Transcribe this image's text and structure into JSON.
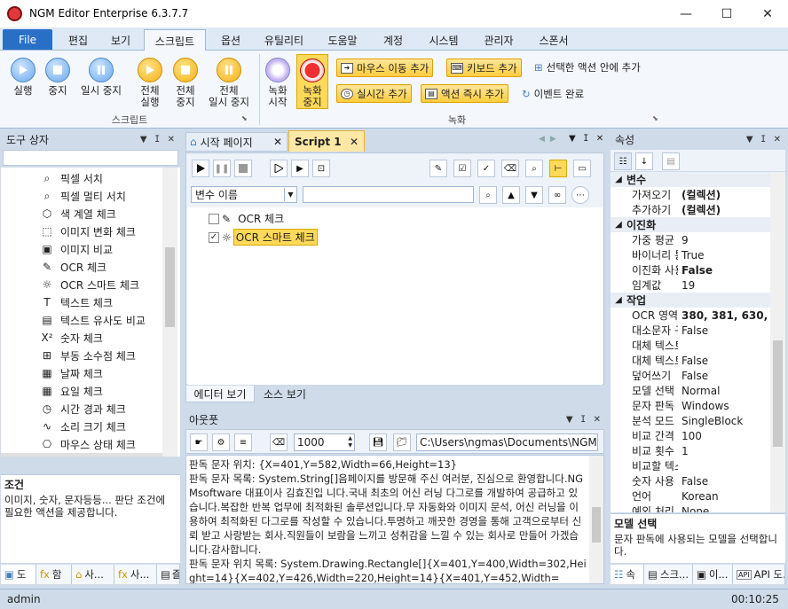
{
  "window": {
    "title": "NGM Editor   Enterprise 6.3.7.7",
    "minimize": "—",
    "maximize": "☐",
    "close": "✕"
  },
  "menu": {
    "file": "File",
    "tabs": [
      "편집",
      "보기",
      "스크립트",
      "옵션",
      "유틸리티",
      "도움말",
      "계정",
      "시스템",
      "관리자",
      "스폰서"
    ]
  },
  "ribbon": {
    "script_group": "스크립트",
    "record_group": "녹화",
    "run": "실행",
    "stop": "중지",
    "pause": "일시 중지",
    "run_all_1": "전체",
    "run_all_2": "실행",
    "stop_all_1": "전체",
    "stop_all_2": "중지",
    "pause_all_1": "전체",
    "pause_all_2": "일시 중지",
    "record_start_1": "녹화",
    "record_start_2": "시작",
    "record_stop_1": "녹화",
    "record_stop_2": "중지",
    "add_mouse_move": "마우스 이동 추가",
    "add_keyboard": "키보드 추가",
    "add_into_selected": "선택한 액션 안에 추가",
    "add_realtime": "실시간 추가",
    "add_action_now": "액션 즉시 추가",
    "event_complete": "이벤트 완료"
  },
  "toolbox": {
    "title": "도구 상자",
    "search_value": "",
    "items": [
      {
        "icon": "magnifier-icon",
        "label": "픽셀 서치"
      },
      {
        "icon": "magnifier-icon",
        "label": "픽셀 멀티 서치"
      },
      {
        "icon": "cube-icon",
        "label": "색 계열 체크"
      },
      {
        "icon": "image-change-icon",
        "label": "이미지 변화 체크"
      },
      {
        "icon": "image-compare-icon",
        "label": "이미지 비교"
      },
      {
        "icon": "ocr-icon",
        "label": "OCR 체크"
      },
      {
        "icon": "bulb-icon",
        "label": "OCR 스마트 체크"
      },
      {
        "icon": "text-icon",
        "label": "텍스트 체크"
      },
      {
        "icon": "text-similar-icon",
        "label": "텍스트 유사도 비교"
      },
      {
        "icon": "number-icon",
        "label": "숫자 체크"
      },
      {
        "icon": "float-icon",
        "label": "부동 소수점 체크"
      },
      {
        "icon": "calendar-icon",
        "label": "날짜 체크"
      },
      {
        "icon": "calendar-day-icon",
        "label": "요일 체크"
      },
      {
        "icon": "clock-icon",
        "label": "시간 경과 체크"
      },
      {
        "icon": "sound-icon",
        "label": "소리 크기 체크"
      },
      {
        "icon": "mouse-icon",
        "label": "마우스 상태 체크"
      }
    ],
    "desc_title": "조건",
    "desc_text": "이미지, 숫자, 문자등등... 판단 조건에 필요한 액션을 제공합니다.",
    "bottom_tabs": [
      "도",
      "함",
      "사...",
      "사...",
      "즐"
    ]
  },
  "editor": {
    "tabs": [
      {
        "label": "시작 페이지"
      },
      {
        "label": "Script 1"
      }
    ],
    "var_select": "변수 이름",
    "var_input": "",
    "tree": [
      {
        "checked": false,
        "label": "OCR 체크"
      },
      {
        "checked": true,
        "label": "OCR 스마트 체크"
      }
    ],
    "view_tabs": [
      "에디터 보기",
      "소스 보기"
    ]
  },
  "output": {
    "title": "아웃풋",
    "number": "1000",
    "path": "C:\\Users\\ngmas\\Documents\\NGM6\\",
    "lines": [
      "판독 문자 위치: {X=401,Y=582,Width=66,Height=13}",
      "판독 문자 목록: System.String[]음페이지를 방문해 주신 여러분, 진심으로 환영합니다.NGMsoftware 대표이사 김효진입 니다.국내 최초의 어신 러닝 다그로를 개발하여 공급하고 있습니다.복잡한 반복 업무에 최적화된 솔루션입니다.무 자동화와 이미지 문석, 어신 러닝을 이용하여 최적화된 다그로를 작성할 수 있습니다.투명하고 깨끗한 경영을 통해 고객으로부터 신뢰 받고 사랑받는 회사.직원들이 보람을 느끼고 성취감을 느낄 수 있는 회사로 만들어 가겠습니다.감사합니다.",
      "판독 문자 위치 목록: System.Drawing.Rectangle[]{X=401,Y=400,Width=302,Height=14}{X=402,Y=426,Width=220,Height=14}{X=401,Y=452,Width="
    ]
  },
  "properties": {
    "title": "속성",
    "categories": [
      {
        "name": "변수",
        "rows": [
          {
            "name": "가져오기",
            "value": "(컬렉션)",
            "bold": true
          },
          {
            "name": "추가하기",
            "value": "(컬렉션)",
            "bold": true
          }
        ]
      },
      {
        "name": "이진화",
        "rows": [
          {
            "name": "가중 평균",
            "value": "9",
            "bold": false
          },
          {
            "name": "바이너리 통",
            "value": "True",
            "bold": false
          },
          {
            "name": "이진화 사용",
            "value": "False",
            "bold": true
          },
          {
            "name": "임계값",
            "value": "19",
            "bold": false
          }
        ]
      },
      {
        "name": "작업",
        "rows": [
          {
            "name": "OCR 영역",
            "value": "380, 381, 630, 3",
            "bold": true
          },
          {
            "name": "대소문자 구",
            "value": "False",
            "bold": false
          },
          {
            "name": "대체 텍스트",
            "value": "",
            "bold": false
          },
          {
            "name": "대체 텍스트",
            "value": "False",
            "bold": false
          },
          {
            "name": "덮어쓰기",
            "value": "False",
            "bold": false
          },
          {
            "name": "모델 선택",
            "value": "Normal",
            "bold": false
          },
          {
            "name": "문자 판독",
            "value": "Windows",
            "bold": false
          },
          {
            "name": "분석 모드",
            "value": "SingleBlock",
            "bold": false
          },
          {
            "name": "비교 간격",
            "value": "100",
            "bold": false
          },
          {
            "name": "비교 횟수",
            "value": "1",
            "bold": false
          },
          {
            "name": "비교할 텍스",
            "value": "",
            "bold": false
          },
          {
            "name": "숫자 사용",
            "value": "False",
            "bold": false
          },
          {
            "name": "언어",
            "value": "Korean",
            "bold": false
          },
          {
            "name": "예외 처리",
            "value": "None",
            "bold": false
          }
        ]
      }
    ],
    "desc_title": "모델 선택",
    "desc_text": "문자 판독에 사용되는 모델을 선택합니다.",
    "bottom_tabs": [
      "속",
      "스크...",
      "이...",
      "API 도..."
    ]
  },
  "status": {
    "user": "admin",
    "time": "00:10:25"
  },
  "colors": {
    "ribbon_bg": "#f4f8fc",
    "file_tab": "#2a6fc6",
    "chrome": "#cfdbe9",
    "highlight": "#ffd95a"
  }
}
